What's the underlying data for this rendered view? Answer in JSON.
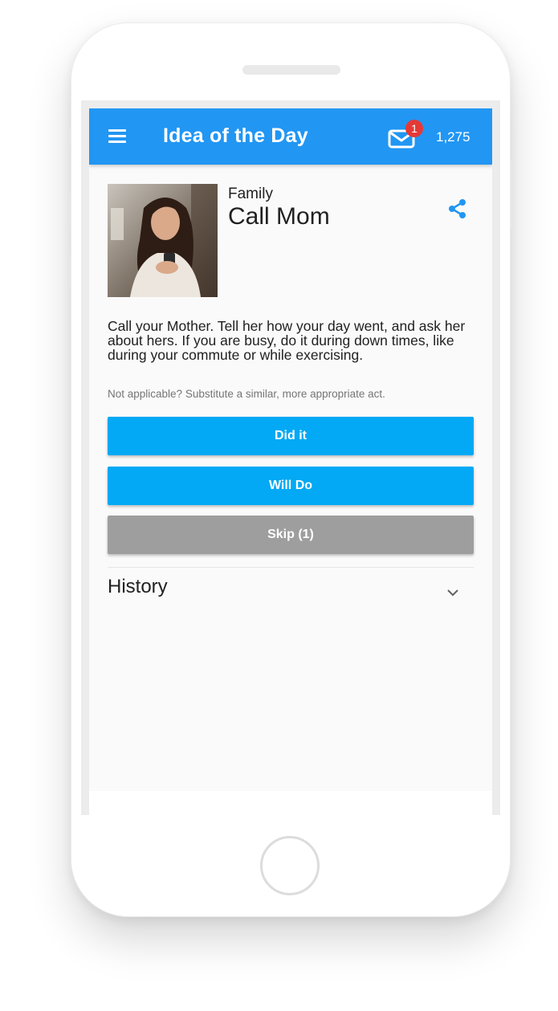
{
  "app": {
    "title": "Idea of the Day",
    "notification_count": "1",
    "points": "1,275"
  },
  "idea": {
    "category": "Family",
    "title": "Call Mom",
    "description": "Call your Mother. Tell her how your day went, and ask her about hers. If you are busy, do it during down times, like during your commute or while exercising.",
    "note": "Not applicable? Substitute a similar, more appropriate act."
  },
  "actions": {
    "did_it": "Did it",
    "will_do": "Will Do",
    "skip": "Skip (1)"
  },
  "history": {
    "label": "History"
  },
  "colors": {
    "app_bar": "#2196f3",
    "primary_button": "#03a9f4",
    "skip_button": "#9e9e9e",
    "badge": "#e53935"
  },
  "icons": [
    "menu-icon",
    "mail-icon",
    "share-icon",
    "chevron-down-icon"
  ]
}
